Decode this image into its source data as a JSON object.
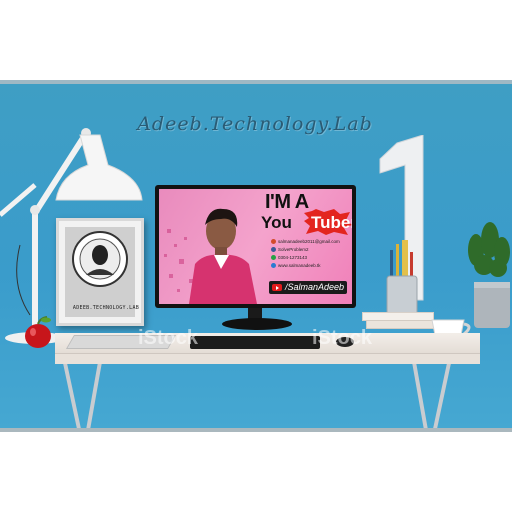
{
  "brand": {
    "text": "Adeeb.Technology.Lab"
  },
  "frame": {
    "caption": "ADEEB.TECHNOLOGY.LAB"
  },
  "screen": {
    "line1": "I'M A",
    "line2a": "You",
    "line2b": "Tuber",
    "contacts": [
      {
        "text": "salmanadeeb2011@gmail.com",
        "color": "#d24b2b"
      },
      {
        "text": "SolveProblem2",
        "color": "#3b5998"
      },
      {
        "text": "0304-1273143",
        "color": "#25a244"
      },
      {
        "text": "www.salmanadeeb.tk",
        "color": "#2a7bd1"
      }
    ],
    "channel": "/SalmanAdeeb"
  },
  "watermarks": [
    "iStock",
    "iStock"
  ],
  "colors": {
    "wall": "#3a9ccb",
    "desk": "#efe9e3",
    "screen_bg": "#f4a3cc",
    "accent_red": "#e21b1b"
  }
}
